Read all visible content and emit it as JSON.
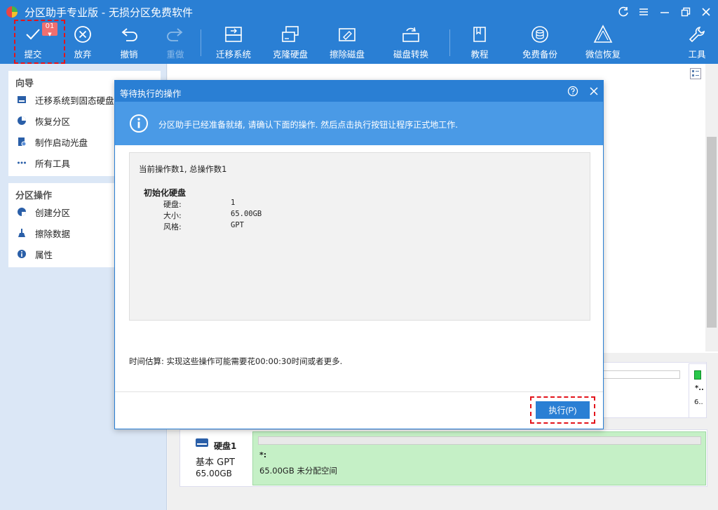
{
  "window": {
    "title": "分区助手专业版 - 无损分区免费软件"
  },
  "toolbar": {
    "pending_count": "01",
    "items": [
      {
        "label": "提交",
        "icon": "check-icon"
      },
      {
        "label": "放弃",
        "icon": "cancel-circle-icon"
      },
      {
        "label": "撤销",
        "icon": "undo-icon"
      },
      {
        "label": "重做",
        "icon": "redo-icon"
      },
      {
        "label": "迁移系统",
        "icon": "migrate-os-icon"
      },
      {
        "label": "克隆硬盘",
        "icon": "clone-disk-icon"
      },
      {
        "label": "擦除磁盘",
        "icon": "wipe-disk-icon"
      },
      {
        "label": "磁盘转换",
        "icon": "convert-disk-icon"
      },
      {
        "label": "教程",
        "icon": "book-icon"
      },
      {
        "label": "免费备份",
        "icon": "backup-icon"
      },
      {
        "label": "微信恢复",
        "icon": "wechat-recovery-icon"
      },
      {
        "label": "工具",
        "icon": "wrench-icon"
      }
    ]
  },
  "sidebar": {
    "wizard": {
      "title": "向导",
      "items": [
        {
          "label": "迁移系统到固态硬盘",
          "icon": "ssd-icon"
        },
        {
          "label": "恢复分区",
          "icon": "recover-icon"
        },
        {
          "label": "制作启动光盘",
          "icon": "boot-disc-icon"
        },
        {
          "label": "所有工具",
          "icon": "more-icon"
        }
      ]
    },
    "partition_ops": {
      "title": "分区操作",
      "items": [
        {
          "label": "创建分区",
          "icon": "pie-icon"
        },
        {
          "label": "擦除数据",
          "icon": "broom-icon"
        },
        {
          "label": "属性",
          "icon": "info-icon"
        }
      ]
    }
  },
  "dialog": {
    "title": "等待执行的操作",
    "info": "分区助手已经准备就绪, 请确认下面的操作. 然后点击执行按钮让程序正式地工作.",
    "op_count": "当前操作数1, 总操作数1",
    "operation": {
      "title": "初始化硬盘",
      "rows": [
        {
          "key": "硬盘:",
          "value": "1"
        },
        {
          "key": "大小:",
          "value": "65.00GB"
        },
        {
          "key": "风格:",
          "value": "GPT"
        }
      ]
    },
    "time_estimate": "时间估算: 实现这些操作可能需要花00:00:30时间或者更多.",
    "execute_label": "执行(P)"
  },
  "disk": {
    "name": "硬盘1",
    "type": "基本 GPT",
    "size": "65.00GB",
    "partition_star": "*:",
    "unallocated": "65.00GB 未分配空间"
  },
  "bg_disk": {
    "star": "*..",
    "size": "6.."
  },
  "colors": {
    "accent": "#2a7fd4",
    "highlight": "#e3141b",
    "unallocated": "#c5f0c6"
  }
}
